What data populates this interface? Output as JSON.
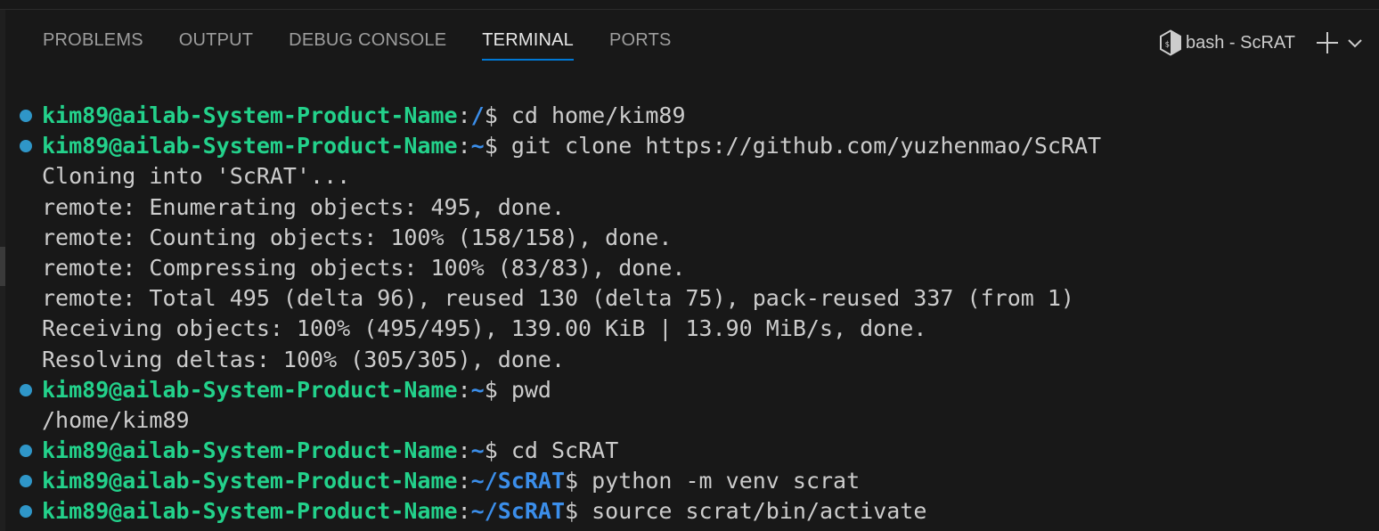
{
  "panel": {
    "tabs": [
      {
        "label": "PROBLEMS"
      },
      {
        "label": "OUTPUT"
      },
      {
        "label": "DEBUG CONSOLE"
      },
      {
        "label": "TERMINAL"
      },
      {
        "label": "PORTS"
      }
    ],
    "active_tab": "TERMINAL",
    "shell_label": "bash - ScRAT"
  },
  "icons": {
    "shell": "bash-shell-icon",
    "new_terminal": "plus-icon",
    "launch_profile": "chevron-down-icon",
    "command_decoration": "circle-dot"
  },
  "colors": {
    "background": "#181818",
    "prompt_user": "#23d18b",
    "prompt_path": "#3b8eea",
    "text": "#cccccc",
    "active_tab_underline": "#0078d4",
    "command_dot": "#2f96c8"
  },
  "terminal": {
    "user_host": "kim89@ailab-System-Product-Name",
    "lines": [
      {
        "kind": "prompt",
        "sep": ":",
        "path": "/",
        "symbol": "$",
        "command": " cd home/kim89"
      },
      {
        "kind": "prompt",
        "sep": ":",
        "path": "~",
        "symbol": "$",
        "command": " git clone https://github.com/yuzhenmao/ScRAT"
      },
      {
        "kind": "output",
        "text": "Cloning into 'ScRAT'..."
      },
      {
        "kind": "output",
        "text": "remote: Enumerating objects: 495, done."
      },
      {
        "kind": "output",
        "text": "remote: Counting objects: 100% (158/158), done."
      },
      {
        "kind": "output",
        "text": "remote: Compressing objects: 100% (83/83), done."
      },
      {
        "kind": "output",
        "text": "remote: Total 495 (delta 96), reused 130 (delta 75), pack-reused 337 (from 1)"
      },
      {
        "kind": "output",
        "text": "Receiving objects: 100% (495/495), 139.00 KiB | 13.90 MiB/s, done."
      },
      {
        "kind": "output",
        "text": "Resolving deltas: 100% (305/305), done."
      },
      {
        "kind": "prompt",
        "sep": ":",
        "path": "~",
        "symbol": "$",
        "command": " pwd"
      },
      {
        "kind": "output",
        "text": "/home/kim89"
      },
      {
        "kind": "prompt",
        "sep": ":",
        "path": "~",
        "symbol": "$",
        "command": " cd ScRAT"
      },
      {
        "kind": "prompt",
        "sep": ":",
        "path": "~/ScRAT",
        "symbol": "$",
        "command": " python -m venv scrat"
      },
      {
        "kind": "prompt",
        "sep": ":",
        "path": "~/ScRAT",
        "symbol": "$",
        "command": " source scrat/bin/activate"
      }
    ]
  }
}
